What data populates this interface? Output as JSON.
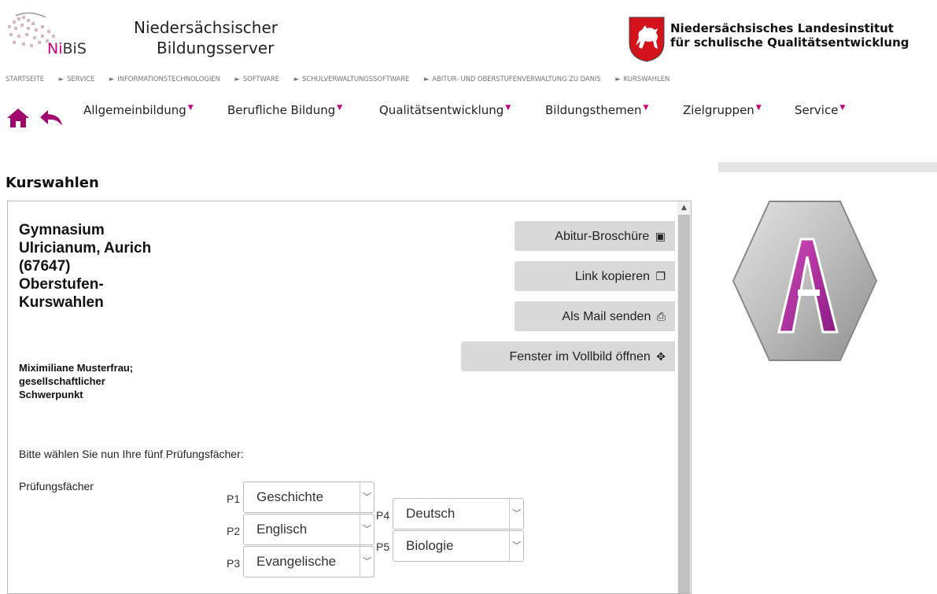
{
  "header": {
    "nibis_logo_prefix": "Ni",
    "nibis_logo_suffix": "BiS",
    "server_title_line1": "Niedersächsischer",
    "server_title_line2": "Bildungsserver",
    "institut_line1": "Niedersächsisches Landesinstitut",
    "institut_line2": "für schulische Qualitätsentwicklung"
  },
  "breadcrumb": [
    "STARTSEITE",
    "SERVICE",
    "INFORMATIONSTECHNOLOGIEN",
    "SOFTWARE",
    "SCHULVERWALTUNGSSOFTWARE",
    "ABITUR- UND OBERSTUFENVERWALTUNG ZU DANIS",
    "KURSWAHLEN"
  ],
  "nav": [
    "Allgemeinbildung",
    "Berufliche Bildung",
    "Qualitätsentwicklung",
    "Bildungsthemen",
    "Zielgruppen",
    "Service"
  ],
  "page_title": "Kurswahlen",
  "frame": {
    "school_lines": [
      "Gymnasium",
      "Ulricianum, Aurich",
      "(67647)",
      "Oberstufen-",
      "Kurswahlen"
    ],
    "person_lines": [
      "Miximiliane Musterfrau;",
      "gesellschaftlicher",
      "Schwerpunkt"
    ],
    "intro": "Bitte wählen Sie nun Ihre fünf Prüfungsfächer:",
    "pf_label": "Prüfungsfächer",
    "buttons": {
      "broschuere": "Abitur-Broschüre",
      "link": "Link kopieren",
      "mail": "Als Mail senden",
      "vollbild": "Fenster im Vollbild öffnen"
    },
    "exams": [
      {
        "label": "P1",
        "value": "Geschichte"
      },
      {
        "label": "P2",
        "value": "Englisch"
      },
      {
        "label": "P3",
        "value": "Evangelische"
      },
      {
        "label": "P4",
        "value": "Deutsch"
      },
      {
        "label": "P5",
        "value": "Biologie"
      }
    ]
  },
  "colors": {
    "accent": "#c8007a",
    "button_bg": "#d9d9d9"
  },
  "icons": [
    "home-icon",
    "back-arrow-icon",
    "pdf-download-icon",
    "copy-icon",
    "print-icon",
    "move-arrows-icon",
    "chevron-down-icon",
    "app-logo-icon"
  ]
}
